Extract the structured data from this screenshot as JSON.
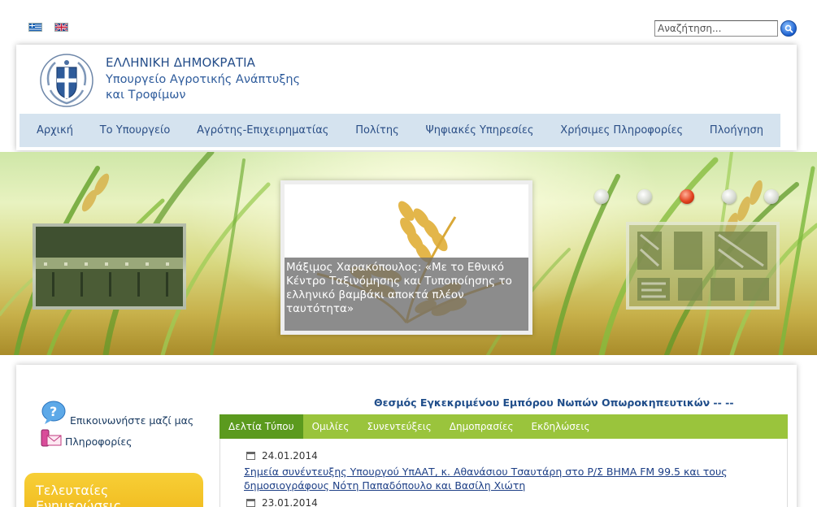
{
  "languages": {
    "greek_flag": "greek-flag-icon",
    "english_flag": "uk-flag-icon"
  },
  "search": {
    "placeholder": "Αναζήτηση...",
    "button_icon": "search-icon"
  },
  "header": {
    "title": "ΕΛΛΗΝΙΚΗ ΔΗΜΟΚΡΑΤΙΑ",
    "ministry_line1": "Υπουργείο Αγροτικής Ανάπτυξης",
    "ministry_line2": "και Τροφίμων",
    "emblem_icon": "greek-coat-of-arms-icon"
  },
  "nav": {
    "items": [
      {
        "label": "Αρχική"
      },
      {
        "label": "Το Υπουργείο"
      },
      {
        "label": "Αγρότης-Επιχειρηματίας"
      },
      {
        "label": "Πολίτης"
      },
      {
        "label": "Ψηφιακές Υπηρεσίες"
      },
      {
        "label": "Χρήσιμες Πληροφορίες"
      },
      {
        "label": "Πλοήγηση"
      }
    ]
  },
  "slider": {
    "feature_caption": "Μάξιμος Χαρακόπουλος: «Με το Εθνικό Κέντρο Ταξινόμησης και Τυποποίησης το ελληνικό βαμβάκι αποκτά πλέον ταυτότητα»",
    "total_slides": 5,
    "active_slide": 3
  },
  "sidebar": {
    "contact_label": "Επικοινωνήστε μαζί μας",
    "info_label": "Πληροφορίες",
    "latest_title": "Τελευταίες Ενημερώσεις"
  },
  "main": {
    "marquee_text": "Θεσμός Εγκεκριμένου Εμπόρου Νωπών Οπωροκηπευτικών -- --",
    "tabs": [
      {
        "label": "Δελτία Τύπου",
        "active": true
      },
      {
        "label": "Ομιλίες",
        "active": false
      },
      {
        "label": "Συνεντεύξεις",
        "active": false
      },
      {
        "label": "Δημοπρασίες",
        "active": false
      },
      {
        "label": "Εκδηλώσεις",
        "active": false
      }
    ],
    "news": [
      {
        "date": "24.01.2014",
        "title": "Σημεία συνέντευξης Υπουργού ΥπΑΑΤ, κ. Αθανάσιου Τσαυτάρη στο Ρ/Σ ΒΗΜΑ FM 99.5 και τους δημοσιογράφους Νότη Παπαδόπουλο και Βασίλη Χιώτη"
      },
      {
        "date": "23.01.2014",
        "title": ""
      }
    ]
  },
  "colors": {
    "nav_bg": "#d5e3ef",
    "nav_text": "#2a4e86",
    "tab_bar": "#9ac43c",
    "tab_active": "#5b9a1e",
    "latest_box": "#f0b81c",
    "link": "#1d3f86"
  }
}
